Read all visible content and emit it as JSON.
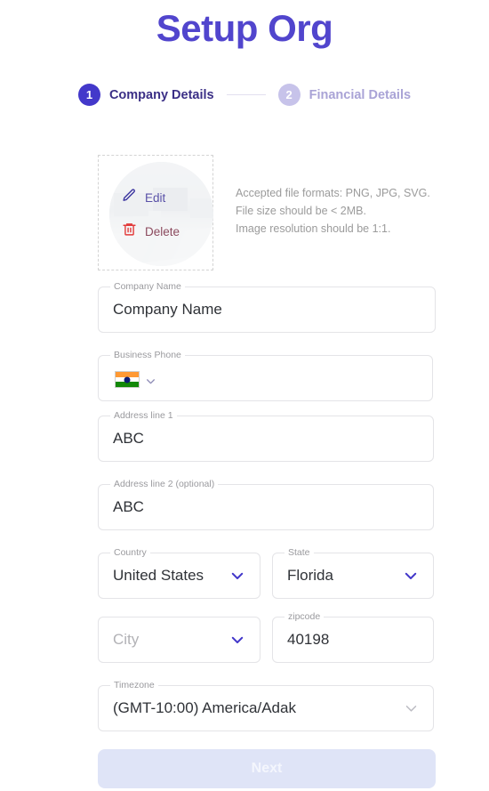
{
  "header": {
    "title": "Setup Org"
  },
  "stepper": {
    "steps": [
      {
        "number": "1",
        "label": "Company Details",
        "state": "active"
      },
      {
        "number": "2",
        "label": "Financial Details",
        "state": "inactive"
      }
    ]
  },
  "upload": {
    "edit_label": "Edit",
    "delete_label": "Delete",
    "edit_icon": "pencil-icon",
    "delete_icon": "trash-icon",
    "hints": [
      "Accepted file formats: PNG, JPG, SVG.",
      "File size should be < 2MB.",
      "Image resolution should be 1:1."
    ]
  },
  "form": {
    "company_name": {
      "label": "Company Name",
      "value": "Company Name"
    },
    "business_phone": {
      "label": "Business Phone",
      "value": "",
      "placeholder": "",
      "country_flag": "india-flag-icon"
    },
    "address_line_1": {
      "label": "Address line 1",
      "value": "ABC"
    },
    "address_line_2": {
      "label": "Address line 2 (optional)",
      "value": "ABC"
    },
    "country": {
      "label": "Country",
      "value": "United States"
    },
    "state": {
      "label": "State",
      "value": "Florida"
    },
    "city": {
      "label": "",
      "value": "",
      "placeholder": "City"
    },
    "zipcode": {
      "label": "zipcode",
      "value": "40198"
    },
    "timezone": {
      "label": "Timezone",
      "value": "(GMT-10:00) America/Adak"
    }
  },
  "footer": {
    "next_label": "Next"
  },
  "colors": {
    "brand": "#5145cd",
    "step_active": "#4338ca",
    "step_inactive": "#c7c3ea",
    "chevron": "#4338ca",
    "chevron_muted": "#bdbdc4",
    "delete": "#e23b3b",
    "next_disabled_bg": "#dfe4f7"
  }
}
